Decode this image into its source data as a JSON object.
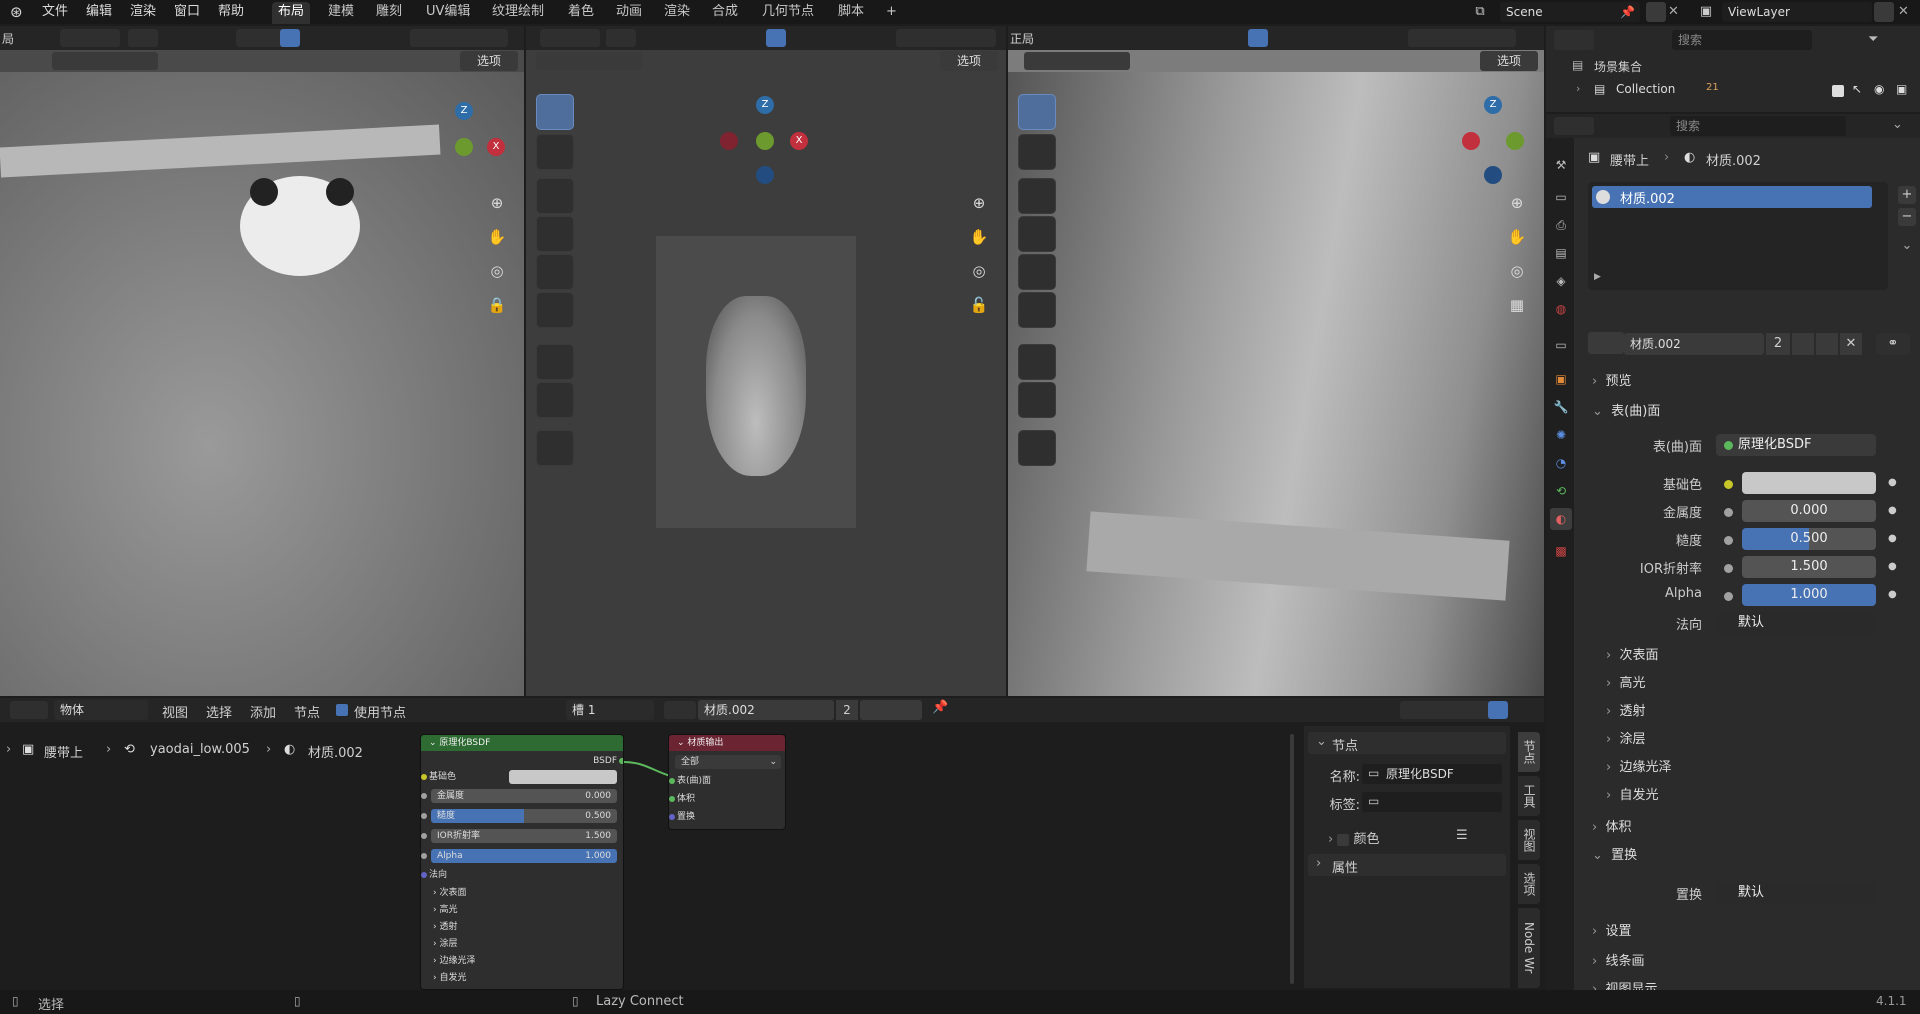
{
  "app": {
    "version": "4.1.1"
  },
  "menu": {
    "items": [
      "文件",
      "编辑",
      "渲染",
      "窗口",
      "帮助"
    ]
  },
  "workspaces": {
    "tabs": [
      "布局",
      "建模",
      "雕刻",
      "UV编辑",
      "纹理绘制",
      "着色",
      "动画",
      "渲染",
      "合成",
      "几何节点",
      "脚本"
    ],
    "active": "布局",
    "add": "+"
  },
  "scene": {
    "name": "Scene",
    "view_layer": "ViewLayer"
  },
  "viewport_left": {
    "mode_fragment": "局",
    "options": "选项"
  },
  "viewport_mid": {
    "options": "选项"
  },
  "viewport_right": {
    "mode_fragment": "正局",
    "options": "选项"
  },
  "outliner": {
    "search_placeholder": "搜索",
    "root": "场景集合",
    "collection": "Collection",
    "collection_count": "21"
  },
  "properties": {
    "search_placeholder": "搜索",
    "breadcrumb_object": "腰带上",
    "breadcrumb_material": "材质.002",
    "slot_name": "材质.002",
    "material_name": "材质.002",
    "users": "2",
    "sections": {
      "preview": "预览",
      "surface": "表(曲)面",
      "volume": "体积",
      "displacement": "置换",
      "settings": "设置",
      "lineart": "线条画",
      "viewport_display": "视图显示"
    },
    "surface_label": "表(曲)面",
    "surface_shader": "原理化BSDF",
    "inputs": [
      {
        "label": "基础色",
        "value": "",
        "color": "#c8c8c8",
        "fill": 1
      },
      {
        "label": "金属度",
        "value": "0.000",
        "fill": 0
      },
      {
        "label": "糙度",
        "value": "0.500",
        "fill": 0.5
      },
      {
        "label": "IOR折射率",
        "value": "1.500",
        "fill": 0
      },
      {
        "label": "Alpha",
        "value": "1.000",
        "fill": 1
      },
      {
        "label": "法向",
        "value": "默认"
      }
    ],
    "subpanels": [
      "次表面",
      "高光",
      "透射",
      "涂层",
      "边缘光泽",
      "自发光"
    ],
    "displacement_label": "置换",
    "displacement_value": "默认"
  },
  "node_editor": {
    "header": {
      "editor": "物体",
      "view": "视图",
      "select": "选择",
      "add": "添加",
      "node": "节点",
      "use_nodes": "使用节点",
      "slot": "槽 1",
      "material": "材质.002",
      "users": "2"
    },
    "breadcrumb": {
      "object": "腰带上",
      "mesh": "yaodai_low.005",
      "material": "材质.002"
    },
    "bsdf": {
      "title": "原理化BSDF",
      "output": "BSDF",
      "base_color": "基础色",
      "metallic": "金属度",
      "metallic_val": "0.000",
      "roughness": "糙度",
      "roughness_val": "0.500",
      "ior": "IOR折射率",
      "ior_val": "1.500",
      "alpha": "Alpha",
      "alpha_val": "1.000",
      "normal": "法向",
      "subs": [
        "次表面",
        "高光",
        "透射",
        "涂层",
        "边缘光泽",
        "自发光"
      ]
    },
    "output": {
      "title": "材质输出",
      "target": "全部",
      "surface": "表(曲)面",
      "volume": "体积",
      "displacement": "置换"
    },
    "sidebar": {
      "node_header": "节点",
      "name_label": "名称:",
      "name_value": "原理化BSDF",
      "tag_label": "标签:",
      "tag_value": "",
      "color": "颜色",
      "properties": "属性"
    },
    "vtabs": [
      "节点",
      "工具",
      "视图",
      "选项",
      "Node Wr"
    ]
  },
  "statusbar": {
    "select": "选择",
    "lazy": "Lazy Connect",
    "version": "4.1.1"
  }
}
